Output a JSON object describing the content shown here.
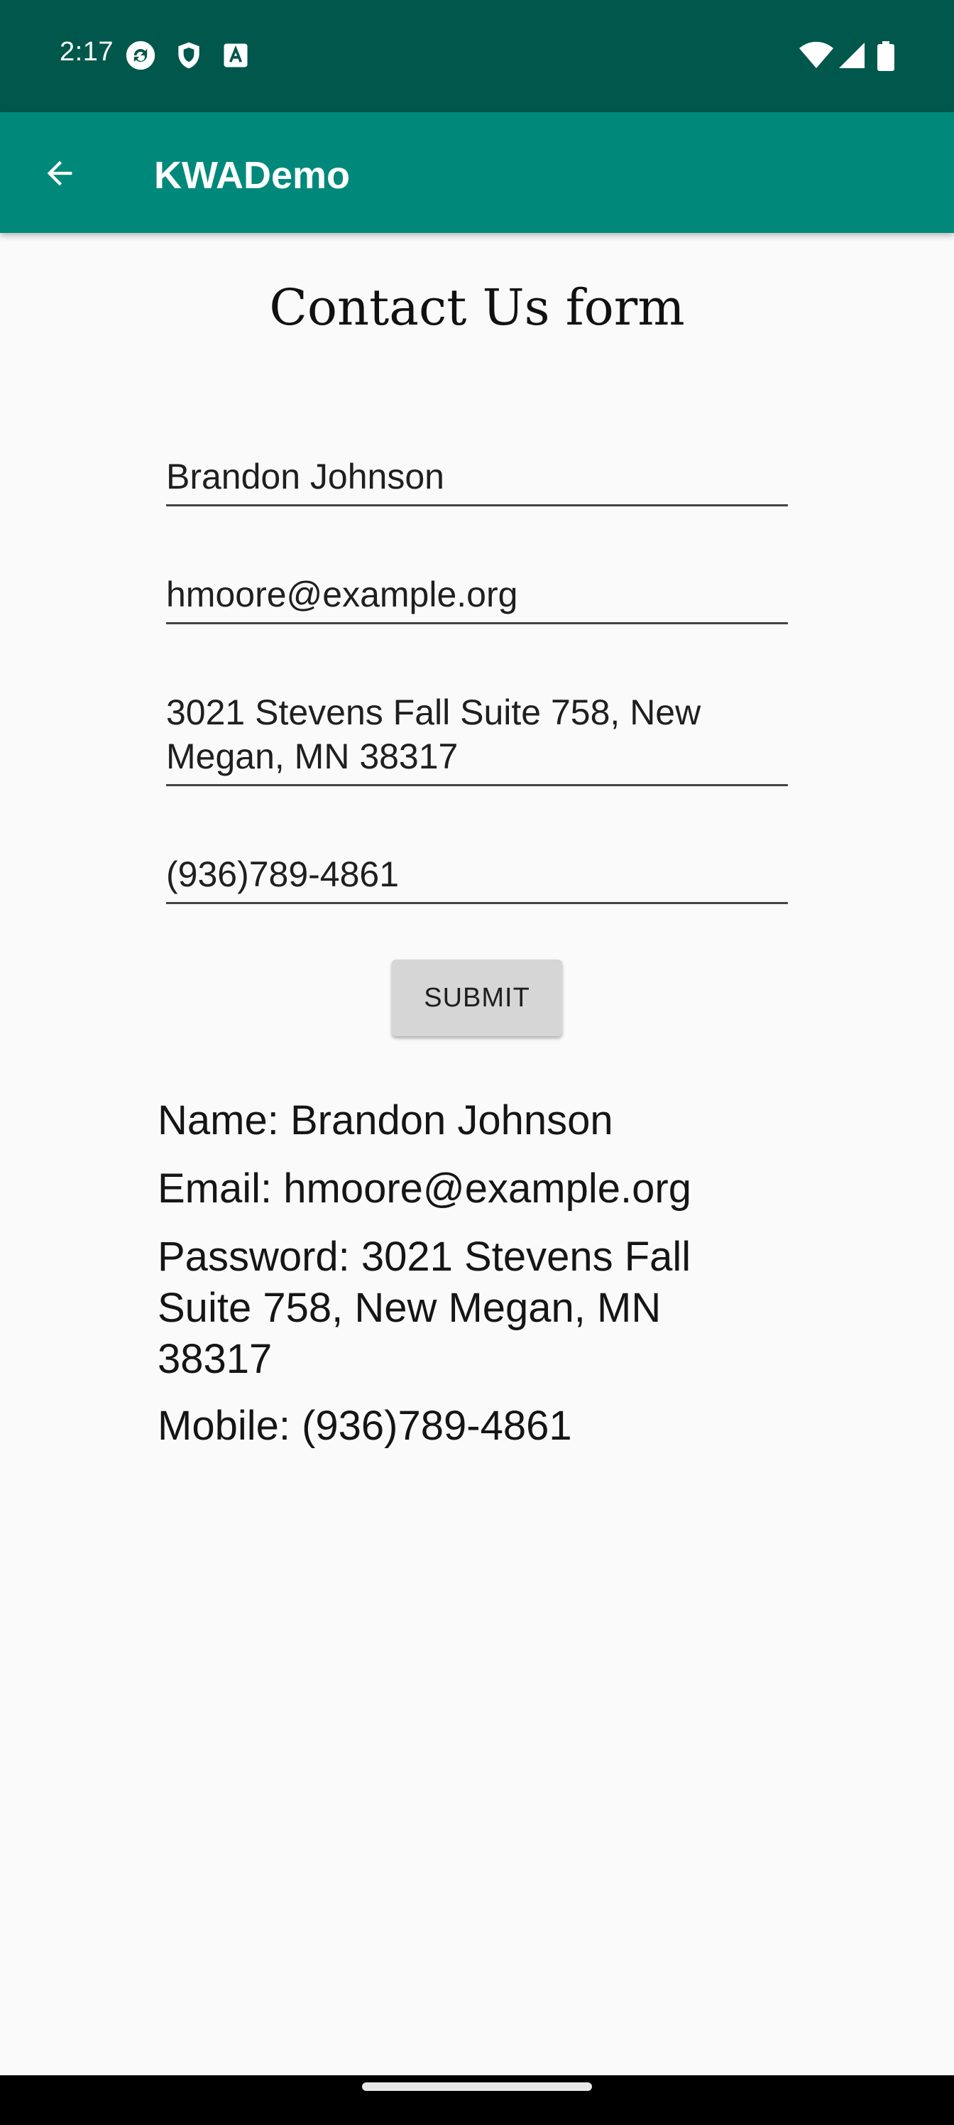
{
  "status_bar": {
    "time": "2:17",
    "left_icons": [
      "sync-icon",
      "shield-icon",
      "font-icon"
    ],
    "right_icons": [
      "wifi-icon",
      "signal-icon",
      "battery-icon"
    ],
    "background": "#00574b"
  },
  "app_bar": {
    "title": "KWADemo",
    "background": "#00897b"
  },
  "form": {
    "title": "Contact Us form",
    "name_value": "Brandon Johnson",
    "email_value": "hmoore@example.org",
    "address_value": "3021 Stevens Fall Suite 758, New Megan, MN 38317",
    "mobile_value": "(936)789-4861",
    "submit_label": "SUBMIT"
  },
  "results": {
    "name_line": "Name: Brandon Johnson",
    "email_line": "Email: hmoore@example.org",
    "password_line": "Password: 3021 Stevens Fall Suite 758, New Megan, MN 38317",
    "mobile_line": "Mobile: (936)789-4861"
  }
}
